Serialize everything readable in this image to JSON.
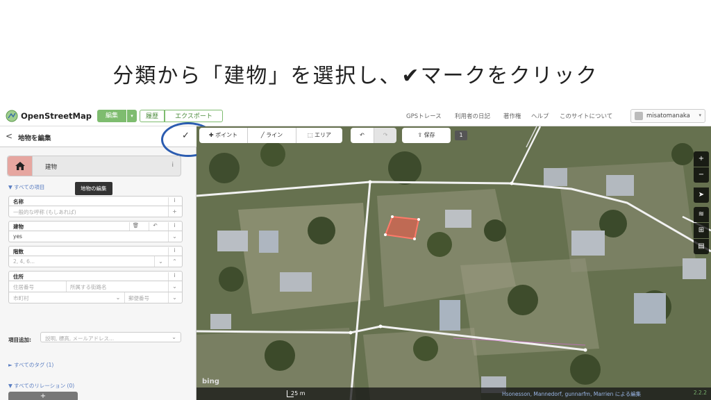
{
  "slide": {
    "caption_before": "分類から「建物」を選択し、",
    "caption_check": "✔",
    "caption_after": "マークをクリック"
  },
  "nav": {
    "brand": "OpenStreetMap",
    "edit": "編集",
    "edit_dropdown": "▾",
    "history": "履歴",
    "export": "エクスポート",
    "links": [
      "GPSトレース",
      "利用者の日記",
      "著作権",
      "ヘルプ",
      "このサイトについて"
    ],
    "user": "misatomanaka",
    "user_dropdown": "▾"
  },
  "sidebar": {
    "back": "<",
    "title": "地物を編集",
    "apply": "✓",
    "preset_name": "建物",
    "info": "i",
    "tooltip": "地物の編集",
    "all_fields": "▼ すべての項目",
    "fields": {
      "name_label": "名称",
      "name_placeholder": "一般的な呼称 (もしあれば)",
      "building_label": "建物",
      "building_value": "yes",
      "levels_label": "階数",
      "levels_placeholder": "2, 4, 6...",
      "address_label": "住所",
      "housenumber_placeholder": "住居番号",
      "street_placeholder": "所属する街路名",
      "city_placeholder": "市町村",
      "postcode_placeholder": "郵便番号"
    },
    "add_field_label": "項目追加:",
    "add_field_placeholder": "説明, 標高, メールアドレス...",
    "all_tags": "► すべてのタグ (1)",
    "all_relations": "▼ すべてのリレーション (0)",
    "add_relation": "+"
  },
  "toolbar": {
    "point": "ポイント",
    "line": "ライン",
    "area": "エリア",
    "save": "保存",
    "save_count": "1"
  },
  "map": {
    "bing": "bing",
    "scale": "25 m",
    "attribution": "Hsonesson, Mannedorf, gunnarfm, Marrien による編集",
    "version": "2.2.2"
  },
  "colors": {
    "osm_green": "#7ebc6f",
    "highlight_ring": "#2b5cb0",
    "selected_area": "#e05a4a",
    "link_blue": "#5a7ec2"
  }
}
